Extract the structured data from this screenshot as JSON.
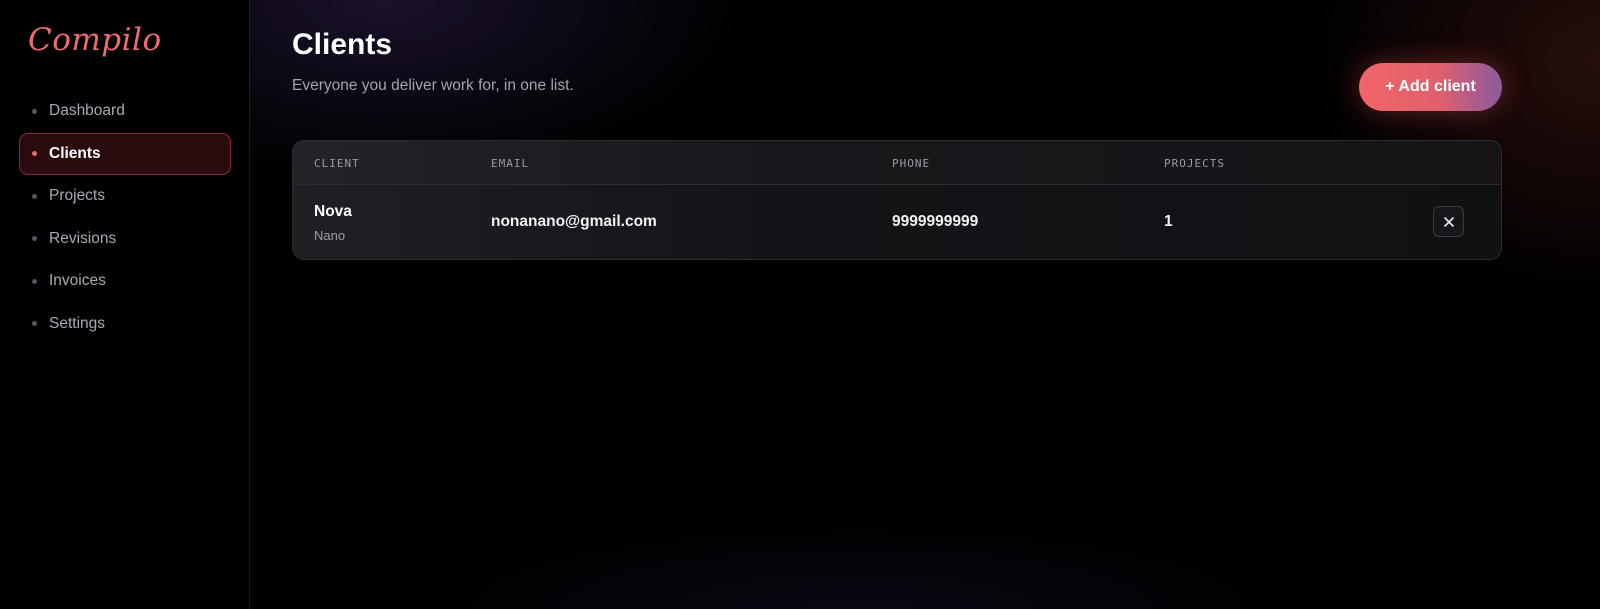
{
  "app": {
    "logo": "Compilo"
  },
  "sidebar": {
    "items": [
      {
        "label": "Dashboard",
        "active": false
      },
      {
        "label": "Clients",
        "active": true
      },
      {
        "label": "Projects",
        "active": false
      },
      {
        "label": "Revisions",
        "active": false
      },
      {
        "label": "Invoices",
        "active": false
      },
      {
        "label": "Settings",
        "active": false
      }
    ]
  },
  "header": {
    "title": "Clients",
    "subtitle": "Everyone you deliver work for, in one list.",
    "add_button_label": "+ Add client"
  },
  "table": {
    "columns": [
      "CLIENT",
      "EMAIL",
      "PHONE",
      "PROJECTS"
    ],
    "rows": [
      {
        "name": "Nova",
        "company": "Nano",
        "email": "nonanano@gmail.com",
        "phone": "9999999999",
        "projects": "1"
      }
    ]
  },
  "colors": {
    "accent": "#f06a72",
    "active_nav_bg": "#2a0c0e",
    "active_nav_border": "#8a2a32",
    "button_gradient_start": "#f26569",
    "button_gradient_end": "#8a5b9e"
  },
  "icons": {
    "delete": "close-icon"
  }
}
